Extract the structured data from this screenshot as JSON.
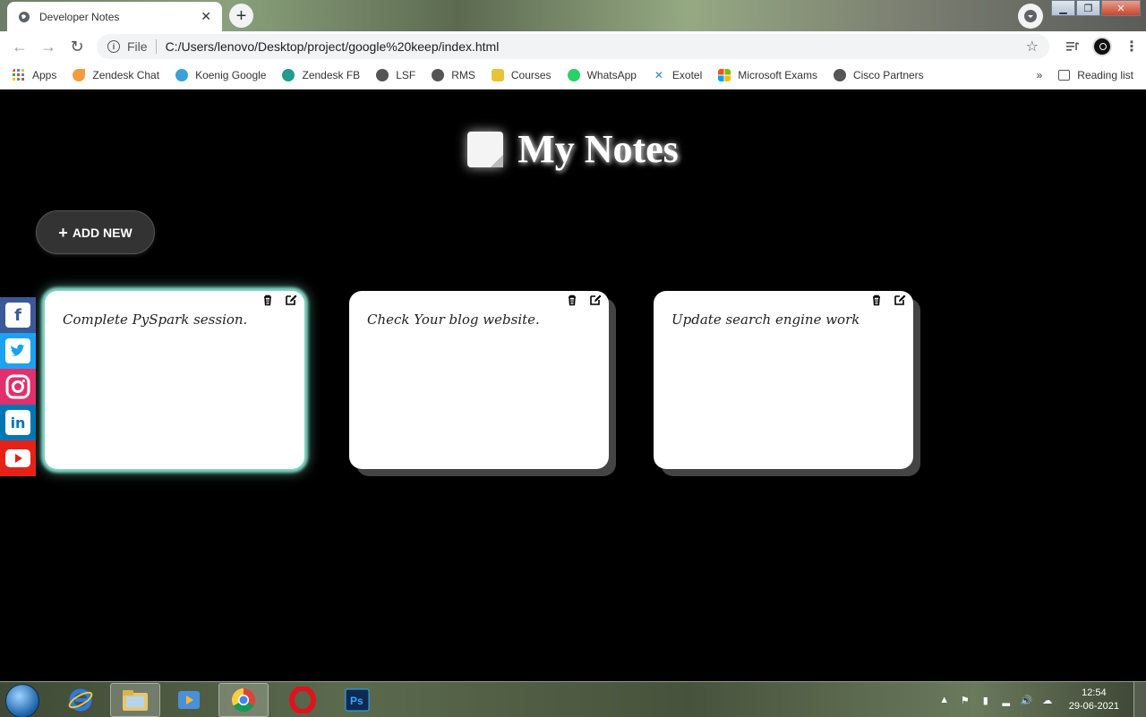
{
  "browser": {
    "tab_title": "Developer Notes",
    "url_scheme": "File",
    "url": "C:/Users/lenovo/Desktop/project/google%20keep/index.html",
    "bookmarks": [
      {
        "label": "Apps",
        "icon": "apps-grid-icon",
        "color": "#4285f4"
      },
      {
        "label": "Zendesk Chat",
        "icon": "zendesk-chat-icon",
        "color": "#f79a3e"
      },
      {
        "label": "Koenig Google",
        "icon": "koenig-icon",
        "color": "#3aa0d8"
      },
      {
        "label": "Zendesk FB",
        "icon": "zendesk-fb-icon",
        "color": "#1f9c8c"
      },
      {
        "label": "LSF",
        "icon": "globe-icon",
        "color": "#555555"
      },
      {
        "label": "RMS",
        "icon": "globe-icon",
        "color": "#555555"
      },
      {
        "label": "Courses",
        "icon": "courses-icon",
        "color": "#e8c33a"
      },
      {
        "label": "WhatsApp",
        "icon": "whatsapp-icon",
        "color": "#25d366"
      },
      {
        "label": "Exotel",
        "icon": "exotel-icon",
        "color": "#3a7bd5"
      },
      {
        "label": "Microsoft Exams",
        "icon": "microsoft-icon",
        "color": "#f25022"
      },
      {
        "label": "Cisco Partners",
        "icon": "globe-icon",
        "color": "#555555"
      }
    ],
    "more_bookmarks": "»",
    "reading_list": "Reading list"
  },
  "page": {
    "heading": "My Notes",
    "add_button": "ADD NEW",
    "notes": [
      {
        "text": "Complete PySpark session.",
        "style": "glow"
      },
      {
        "text": "Check Your blog website.",
        "style": "shadow"
      },
      {
        "text": "Update search engine work",
        "style": "shadow"
      }
    ],
    "social": [
      {
        "icon": "facebook-icon",
        "glyph": "f",
        "color": "#3b5998"
      },
      {
        "icon": "twitter-icon",
        "glyph": "t",
        "color": "#1da1f2"
      },
      {
        "icon": "instagram-icon",
        "glyph": "◎",
        "color": "#e1306c"
      },
      {
        "icon": "linkedin-icon",
        "glyph": "in",
        "color": "#0077b5"
      },
      {
        "icon": "youtube-icon",
        "glyph": "▶",
        "color": "#e62117"
      }
    ]
  },
  "taskbar": {
    "time": "12:54",
    "date": "29-06-2021",
    "accent": "#2b6cb0"
  }
}
